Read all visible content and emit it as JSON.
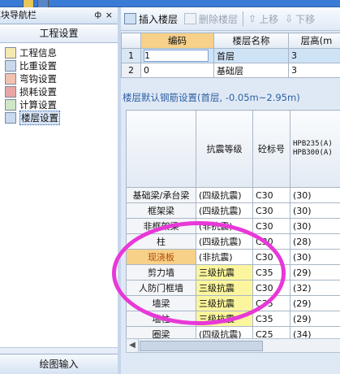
{
  "left_panel": {
    "title": "模块导航栏",
    "pin_glyph": "ф",
    "close_glyph": "×",
    "section_label": "工程设置",
    "items": [
      {
        "label": "工程信息",
        "icon": "info-icon"
      },
      {
        "label": "比重设置",
        "icon": "weight-icon"
      },
      {
        "label": "弯钩设置",
        "icon": "hook-icon"
      },
      {
        "label": "损耗设置",
        "icon": "loss-icon"
      },
      {
        "label": "计算设置",
        "icon": "calc-icon"
      },
      {
        "label": "楼层设置",
        "icon": "floor-icon"
      }
    ],
    "bottom_label": "绘图输入"
  },
  "toolbar": {
    "insert_floor": "插入楼层",
    "delete_floor": "删除楼层",
    "move_up": "上移",
    "move_down": "下移"
  },
  "floors_table": {
    "headers": [
      "编码",
      "楼层名称",
      "层高(m"
    ],
    "rows": [
      {
        "num": "1",
        "code": "1",
        "name": "首层",
        "height": "3"
      },
      {
        "num": "2",
        "code": "0",
        "name": "基础层",
        "height": "3"
      }
    ]
  },
  "rebar_section": {
    "title": "楼层默认钢筋设置(首层, -0.05m~2.95m)",
    "headers": {
      "grade": "抗震等级",
      "concrete": "砼标号",
      "steel_line1": "HPB235(A)",
      "steel_line2": "HPB300(A)"
    },
    "rows": [
      {
        "name": "基础梁/承台梁",
        "grade": "(四级抗震)",
        "concrete": "C30",
        "value": "(30)"
      },
      {
        "name": "框架梁",
        "grade": "(四级抗震)",
        "concrete": "C30",
        "value": "(30)"
      },
      {
        "name": "非框架梁",
        "grade": "(非抗震)",
        "concrete": "C30",
        "value": "(30)"
      },
      {
        "name": "柱",
        "grade": "(四级抗震)",
        "concrete": "C30",
        "value": "(28)"
      },
      {
        "name": "现浇板",
        "grade": "(非抗震)",
        "concrete": "C30",
        "value": "(30)"
      },
      {
        "name": "剪力墙",
        "grade": "三级抗震",
        "concrete": "C35",
        "value": "(29)"
      },
      {
        "name": "人防门框墙",
        "grade": "三级抗震",
        "concrete": "C30",
        "value": "(32)"
      },
      {
        "name": "墙梁",
        "grade": "三级抗震",
        "concrete": "C35",
        "value": "(29)"
      },
      {
        "name": "墙柱",
        "grade": "三级抗震",
        "concrete": "C35",
        "value": "(29)"
      },
      {
        "name": "圈梁",
        "grade": "(四级抗震)",
        "concrete": "C25",
        "value": "(34)"
      }
    ]
  },
  "colors": {
    "highlight_oval": "#e838d7",
    "selected_row": "#f7d08a",
    "yellow_cell": "#fbf69d"
  }
}
